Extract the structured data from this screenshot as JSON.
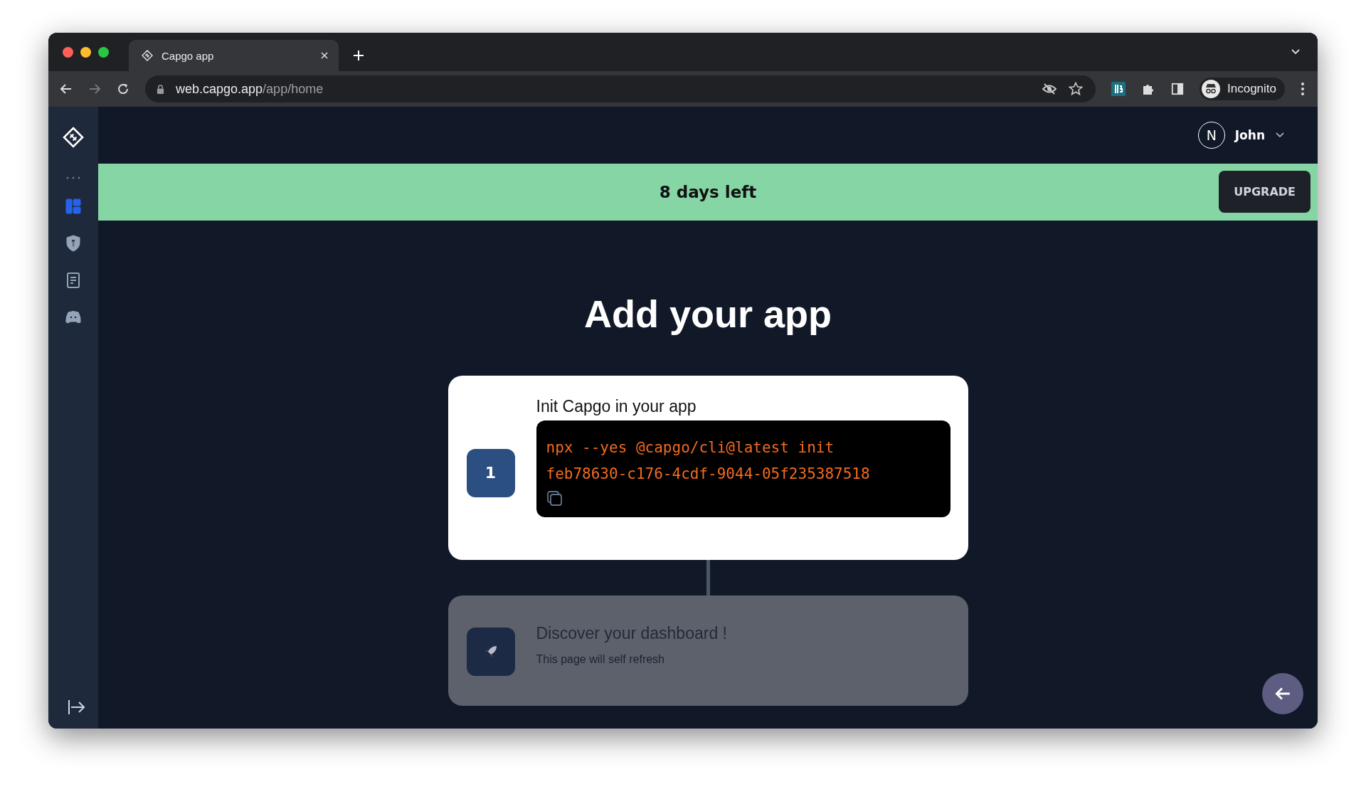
{
  "browser": {
    "tab": {
      "title": "Capgo app"
    },
    "url": {
      "host": "web.capgo.app",
      "path": "/app/home"
    },
    "profile": {
      "label": "Incognito"
    }
  },
  "sidebar": {
    "items": [
      {
        "selected": true
      },
      {
        "selected": false
      },
      {
        "selected": false
      },
      {
        "selected": false
      }
    ]
  },
  "header": {
    "user": {
      "initial": "N",
      "name": "John"
    }
  },
  "banner": {
    "text": "8 days left",
    "button": "UPGRADE"
  },
  "heading": "Add your app",
  "steps": [
    {
      "kind": "number",
      "badge": "1",
      "title": "Init Capgo in your app",
      "code": "npx --yes @capgo/cli@latest init feb78630-c176-4cdf-9044-05f235387518",
      "active": true
    },
    {
      "kind": "rocket",
      "title": "Discover your dashboard !",
      "subtitle": "This page will self refresh",
      "active": false
    }
  ]
}
